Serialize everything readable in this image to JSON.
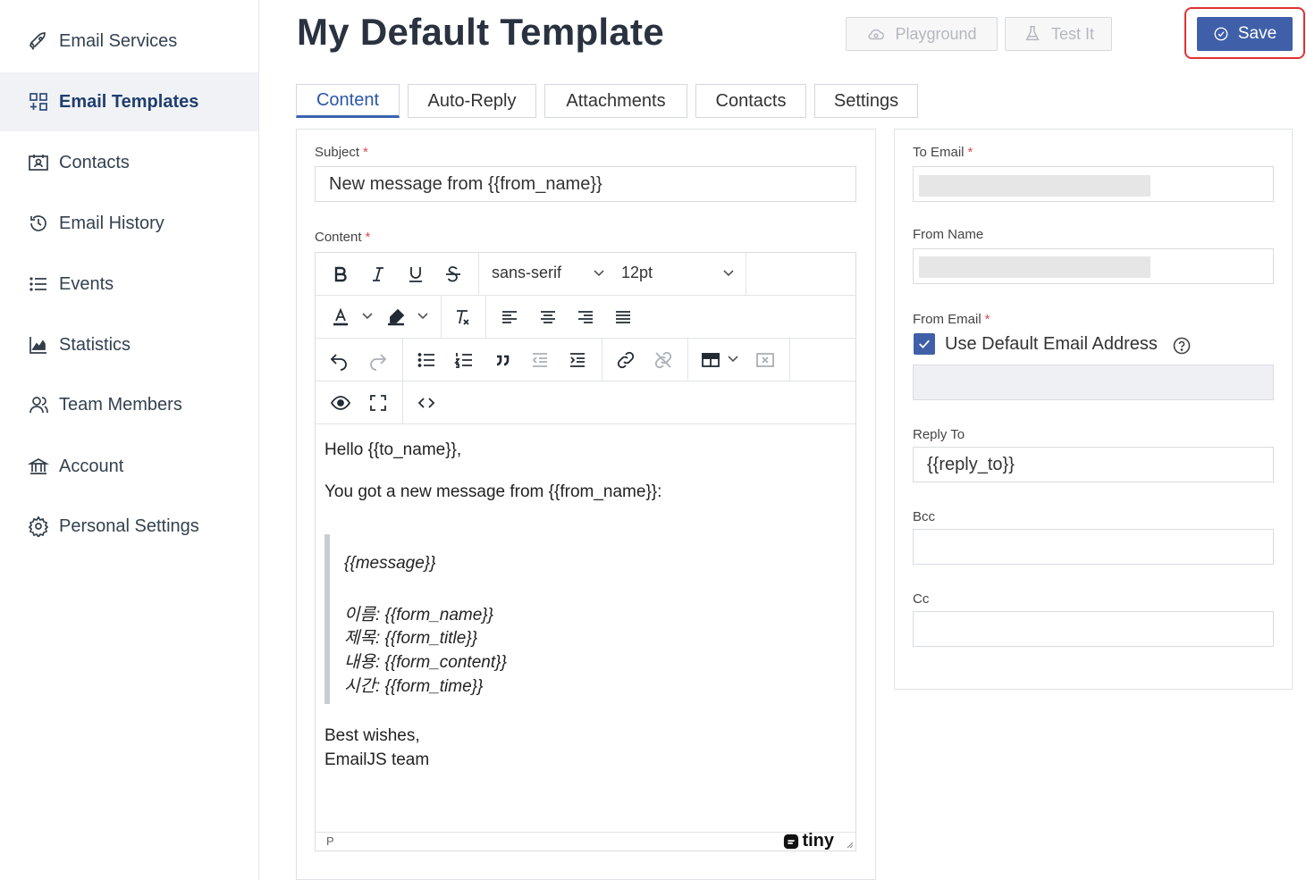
{
  "page": {
    "title": "My Default Template"
  },
  "sidebar": {
    "items": [
      {
        "label": "Email Services",
        "icon": "rocket-icon",
        "active": false
      },
      {
        "label": "Email Templates",
        "icon": "templates-grid-icon",
        "active": true
      },
      {
        "label": "Contacts",
        "icon": "contacts-card-icon",
        "active": false
      },
      {
        "label": "Email History",
        "icon": "history-clock-icon",
        "active": false
      },
      {
        "label": "Events",
        "icon": "list-icon",
        "active": false
      },
      {
        "label": "Statistics",
        "icon": "chart-icon",
        "active": false
      },
      {
        "label": "Team Members",
        "icon": "team-icon",
        "active": false
      },
      {
        "label": "Account",
        "icon": "bank-icon",
        "active": false
      },
      {
        "label": "Personal Settings",
        "icon": "gear-icon",
        "active": false
      }
    ]
  },
  "header": {
    "playground_label": "Playground",
    "test_label": "Test It",
    "save_label": "Save"
  },
  "tabs": [
    {
      "label": "Content",
      "active": true
    },
    {
      "label": "Auto-Reply",
      "active": false
    },
    {
      "label": "Attachments",
      "active": false
    },
    {
      "label": "Contacts",
      "active": false
    },
    {
      "label": "Settings",
      "active": false
    }
  ],
  "content_form": {
    "subject_label": "Subject",
    "subject_value": "New message from {{from_name}}",
    "content_label": "Content",
    "required_mark": "*"
  },
  "editor": {
    "font_family": "sans-serif",
    "font_size": "12pt",
    "body": {
      "greeting": "Hello {{to_name}},",
      "intro": "You got a new message from {{from_name}}:",
      "quote_lines": [
        "{{message}}",
        "이름: {{form_name}}",
        "제목: {{form_title}}",
        "내용: {{form_content}}",
        "시간: {{form_time}}"
      ],
      "closing1": "Best wishes,",
      "closing2": "EmailJS team"
    },
    "status_path": "P",
    "brand": "tiny"
  },
  "settings_form": {
    "to_email_label": "To Email",
    "from_name_label": "From Name",
    "from_email_label": "From Email",
    "use_default_label": "Use Default Email Address",
    "use_default_checked": true,
    "reply_to_label": "Reply To",
    "reply_to_value": "{{reply_to}}",
    "bcc_label": "Bcc",
    "cc_label": "Cc"
  },
  "colors": {
    "primary": "#3f5fa8",
    "highlight_border": "#e03131",
    "required": "#e24b4b"
  }
}
